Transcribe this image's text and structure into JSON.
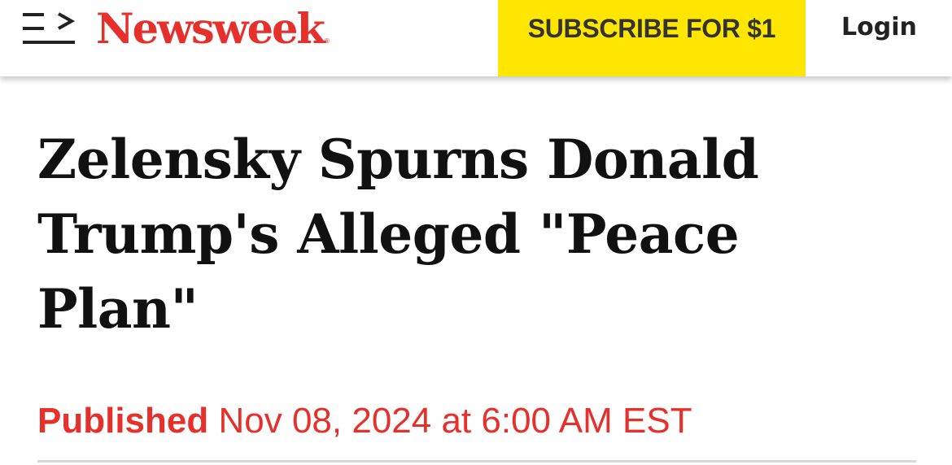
{
  "header": {
    "menu_icon": "menu-arrow-icon",
    "logo_text": "Newsweek",
    "logo_mark": "®",
    "subscribe_label": "SUBSCRIBE FOR $1",
    "login_label": "Login"
  },
  "article": {
    "headline": "Zelensky Spurns Donald Trump's Alleged \"Peace Plan\"",
    "published_label": "Published",
    "published_date": "Nov 08, 2024 at 6:00 AM EST"
  },
  "colors": {
    "brand_red": "#e5302b",
    "subscribe_yellow": "#ffe600",
    "text_dark": "#111111"
  }
}
